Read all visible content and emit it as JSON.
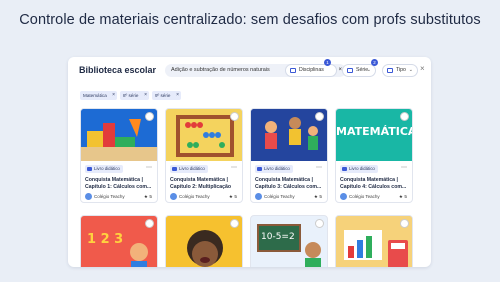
{
  "headline": "Controle de materiais centralizado: sem desafios com profs substitutos",
  "panel": {
    "title": "Biblioteca escolar",
    "search_chip": "Adição e subtração de números naturais",
    "close_symbol": "×",
    "filters": [
      {
        "label": "Disciplinas",
        "badge": "1"
      },
      {
        "label": "Série",
        "badge": "2"
      },
      {
        "label": "Tipo",
        "badge": ""
      }
    ],
    "active_tags": [
      "Matemática",
      "8º série",
      "9º série"
    ]
  },
  "cards": [
    {
      "type": "Livro didático",
      "title1": "Conquista Matemática |",
      "title2": "Capítulo 1: Cálculos com...",
      "school": "Colégio Teachy",
      "rating": "5"
    },
    {
      "type": "Livro didático",
      "title1": "Conquista Matemática |",
      "title2": "Capítulo 2: Multiplicação",
      "school": "Colégio Teachy",
      "rating": "5"
    },
    {
      "type": "Livro didático",
      "title1": "Conquista Matemática |",
      "title2": "Capítulo 3: Cálculos com...",
      "school": "Colégio Teachy",
      "rating": "5"
    },
    {
      "type": "Livro didático",
      "title1": "Conquista Matemática |",
      "title2": "Capítulo 4: Cálculos com...",
      "school": "Colégio Teachy",
      "rating": "5"
    }
  ],
  "cover_text": {
    "matematica": "MATEMÁTICA",
    "board": "10-5=2",
    "numbers": "1 2 3"
  },
  "icons": {
    "card_more": "more-dots-icon",
    "rating": "star-icon",
    "school": "school-logo-icon"
  },
  "colors": {
    "accent": "#3b59d6",
    "background": "#e9eef6"
  }
}
